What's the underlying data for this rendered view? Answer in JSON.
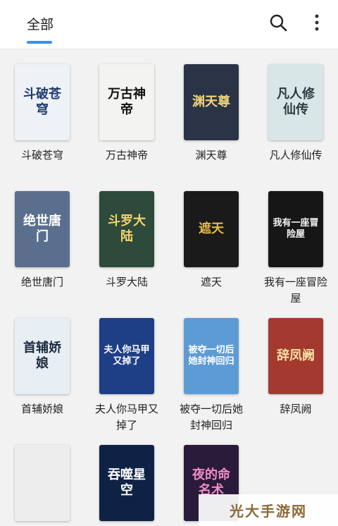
{
  "header": {
    "tab_label": "全部",
    "accent_color": "#3b8ef2",
    "search_icon": "search-icon",
    "more_icon": "more-vertical-icon"
  },
  "books": [
    {
      "title": "斗破苍穹",
      "cover_text": "斗破苍穹",
      "cover_bg": "#eef1f5",
      "cover_fg": "#1f3b6e"
    },
    {
      "title": "万古神帝",
      "cover_text": "万古神帝",
      "cover_bg": "#f3f3f1",
      "cover_fg": "#111111"
    },
    {
      "title": "渊天尊",
      "cover_text": "渊天尊",
      "cover_bg": "#2a3446",
      "cover_fg": "#f0d37a"
    },
    {
      "title": "凡人修仙传",
      "cover_text": "凡人修仙传",
      "cover_bg": "#d9e6e8",
      "cover_fg": "#2c3a40"
    },
    {
      "title": "绝世唐门",
      "cover_text": "绝世唐门",
      "cover_bg": "#5a6f8e",
      "cover_fg": "#ffffff"
    },
    {
      "title": "斗罗大陆",
      "cover_text": "斗罗大陆",
      "cover_bg": "#2d4a3a",
      "cover_fg": "#f6d36b"
    },
    {
      "title": "遮天",
      "cover_text": "遮天",
      "cover_bg": "#1a1a1a",
      "cover_fg": "#e7b84a"
    },
    {
      "title": "我有一座冒险屋",
      "cover_text": "我有一座冒险屋",
      "cover_bg": "#161616",
      "cover_fg": "#f2f2f2"
    },
    {
      "title": "首辅娇娘",
      "cover_text": "首辅娇娘",
      "cover_bg": "#e7eef4",
      "cover_fg": "#1b2a3c"
    },
    {
      "title": "夫人你马甲又掉了",
      "cover_text": "夫人你马甲又掉了",
      "cover_bg": "#1e3f86",
      "cover_fg": "#ffffff"
    },
    {
      "title": "被夺一切后她封神回归",
      "cover_text": "被夺一切后她封神回归",
      "cover_bg": "#5d9bd6",
      "cover_fg": "#ffffff"
    },
    {
      "title": "辞凤阙",
      "cover_text": "辞凤阙",
      "cover_bg": "#a4392f",
      "cover_fg": "#f5e1a4"
    },
    {
      "title": "",
      "cover_text": "",
      "cover_bg": "#ededed",
      "cover_fg": "#222222"
    },
    {
      "title": "",
      "cover_text": "吞噬星空",
      "cover_bg": "#0f2246",
      "cover_fg": "#ffffff"
    },
    {
      "title": "",
      "cover_text": "夜的命名术",
      "cover_bg": "#2a1b3a",
      "cover_fg": "#f08cc7"
    }
  ],
  "watermark": {
    "text": "光大手游网"
  }
}
